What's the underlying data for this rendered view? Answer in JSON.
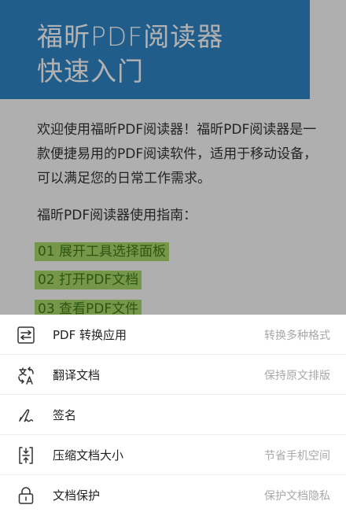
{
  "document": {
    "title_line1": "福昕PDF阅读器",
    "title_line2": "快速入门",
    "intro": "欢迎使用福昕PDF阅读器！福昕PDF阅读器是一款便捷易用的PDF阅读软件，适用于移动设备，可以满足您的日常工作需求。",
    "guide_heading": "福昕PDF阅读器使用指南：",
    "steps": [
      {
        "label": "01  展开工具选择面板"
      },
      {
        "label": "02  打开PDF文档"
      },
      {
        "label": "03  查看PDF文件"
      }
    ]
  },
  "menu": {
    "items": [
      {
        "label": "PDF 转换应用",
        "hint": "转换多种格式",
        "icon": "convert-icon"
      },
      {
        "label": "翻译文档",
        "hint": "保持原文排版",
        "icon": "translate-icon"
      },
      {
        "label": "签名",
        "hint": "",
        "icon": "signature-icon"
      },
      {
        "label": "压缩文档大小",
        "hint": "节省手机空间",
        "icon": "compress-icon"
      },
      {
        "label": "文档保护",
        "hint": "保护文档隐私",
        "icon": "lock-icon"
      }
    ]
  },
  "colors": {
    "banner": "#2f86c7",
    "highlight": "#a9d96b",
    "highlight_text": "#3f7a1a",
    "overlay": "rgba(0,0,0,0.30)"
  }
}
